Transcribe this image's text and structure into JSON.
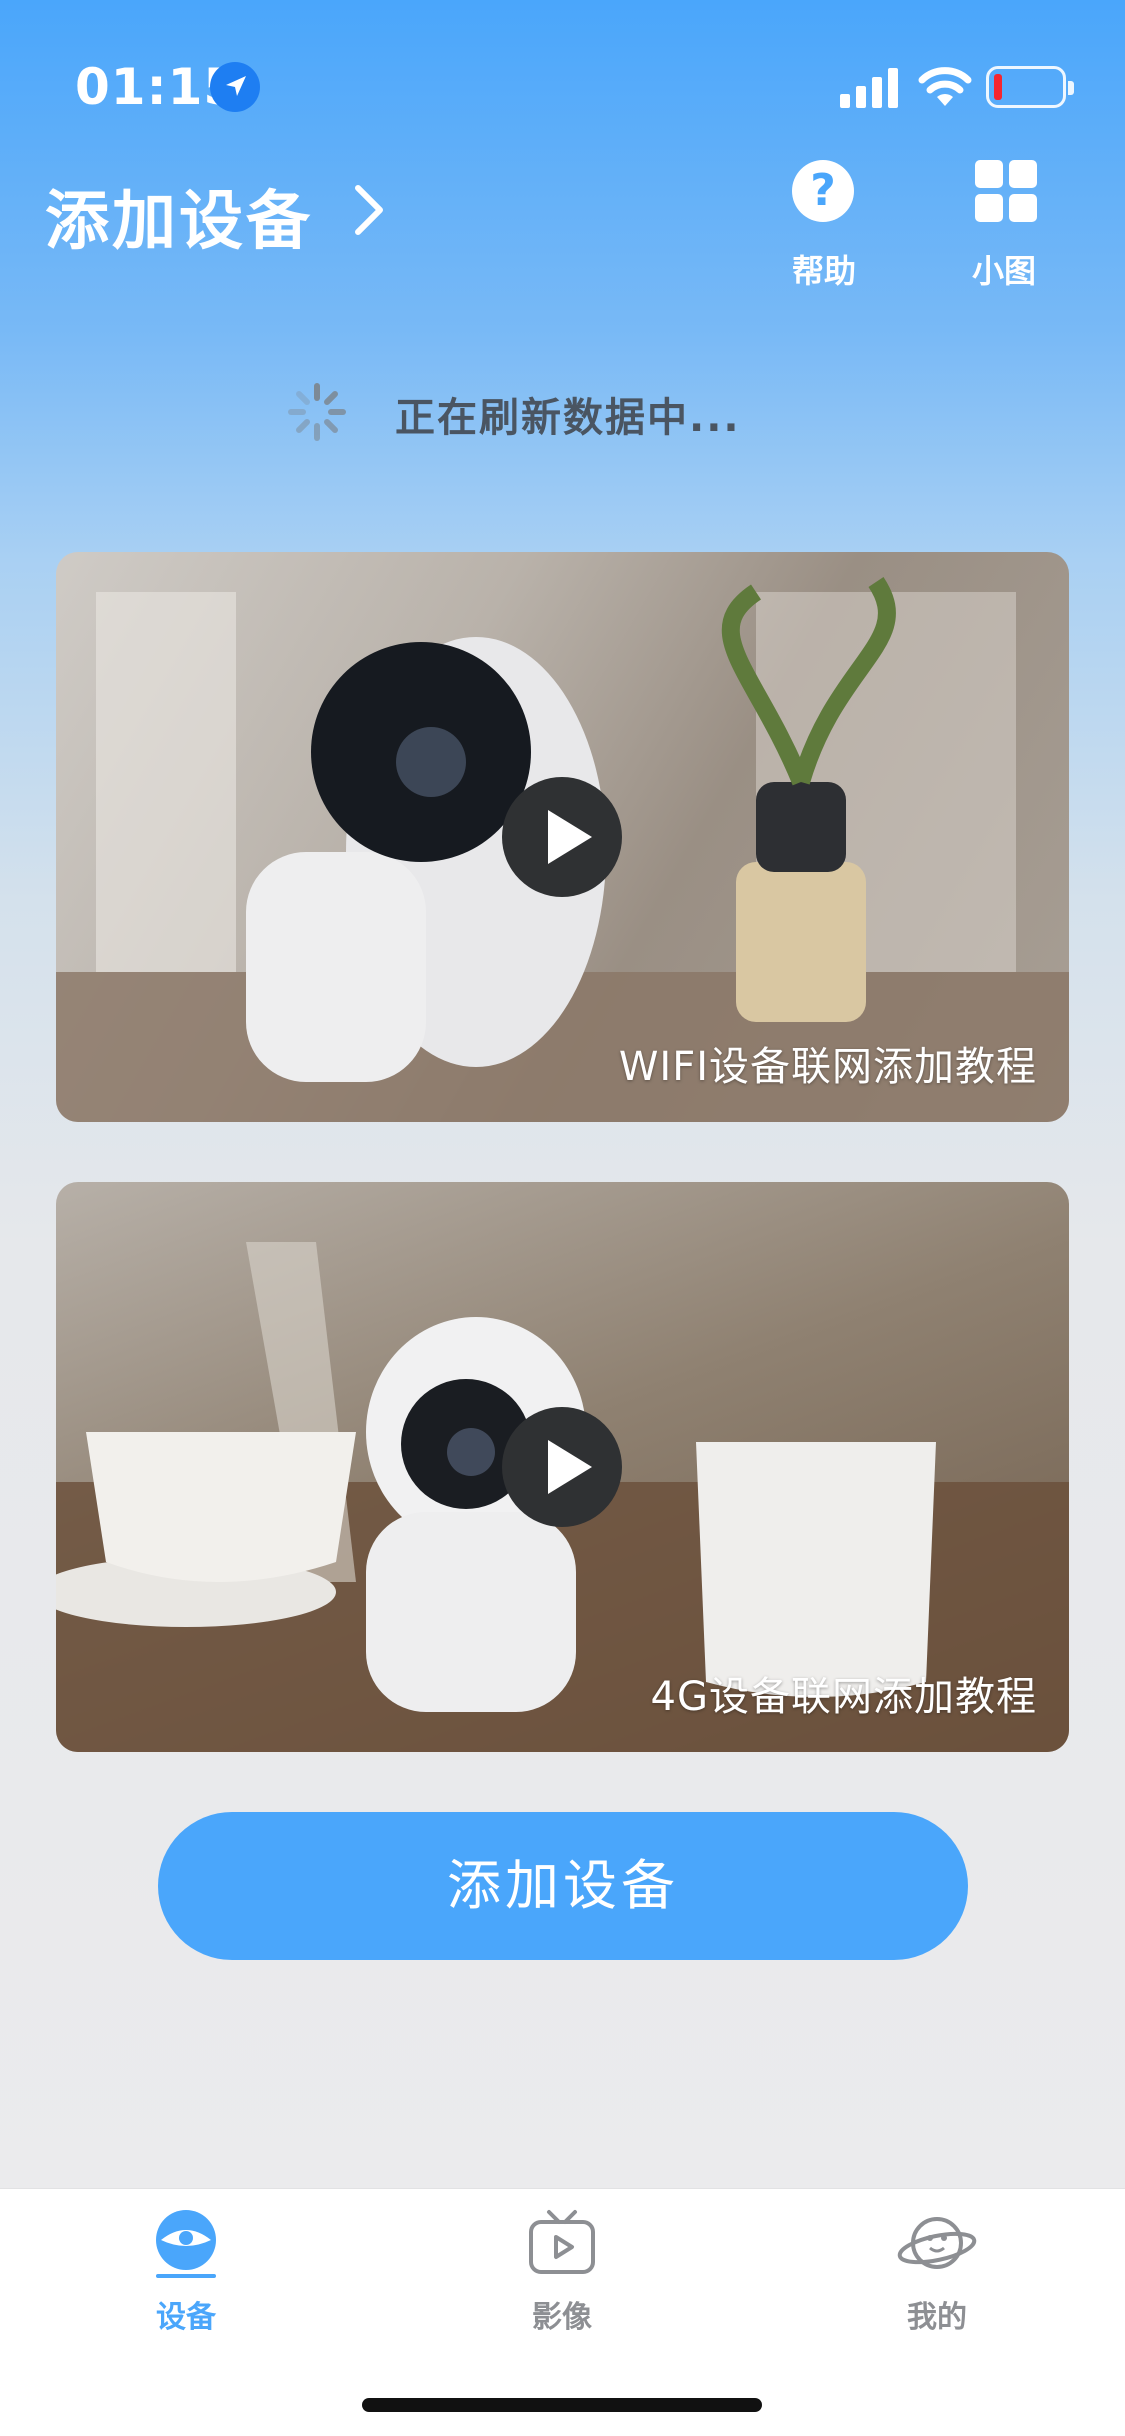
{
  "status_bar": {
    "time": "01:15"
  },
  "header": {
    "title": "添加设备",
    "help_label": "帮助",
    "grid_label": "小图"
  },
  "loading": {
    "text": "正在刷新数据中..."
  },
  "tutorials": [
    {
      "label": "WIFI设备联网添加教程"
    },
    {
      "label": "4G设备联网添加教程"
    }
  ],
  "add_button": {
    "label": "添加设备"
  },
  "tabs": [
    {
      "label": "设备",
      "active": true
    },
    {
      "label": "影像",
      "active": false
    },
    {
      "label": "我的",
      "active": false
    }
  ],
  "colors": {
    "accent": "#4aa6fb",
    "inactive": "#8d8f93",
    "battery_low": "#f4262f"
  }
}
